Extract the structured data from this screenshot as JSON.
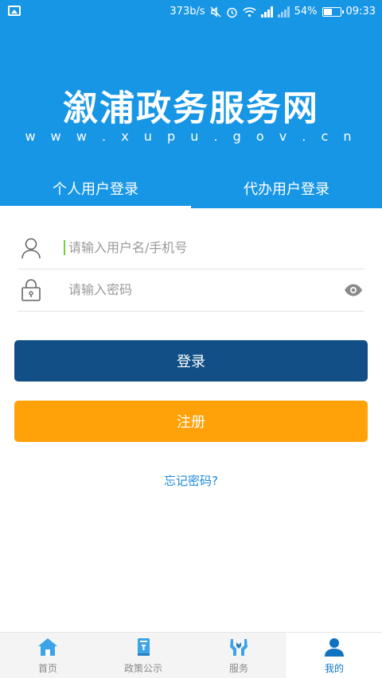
{
  "status_bar": {
    "speed": "373b/s",
    "battery_percent": "54%",
    "battery_level": 0.54,
    "time": "09:33"
  },
  "header": {
    "title": "溆浦政务服务网",
    "url": "w w w . x u p u . g o v . c n"
  },
  "login_tabs": [
    {
      "label": "个人用户登录",
      "active": true
    },
    {
      "label": "代办用户登录",
      "active": false
    }
  ],
  "form": {
    "username_placeholder": "请输入用户名/手机号",
    "password_placeholder": "请输入密码",
    "login_label": "登录",
    "register_label": "注册",
    "forgot_label": "忘记密码?"
  },
  "tabbar": [
    {
      "label": "首页",
      "icon": "home-icon"
    },
    {
      "label": "政策公示",
      "icon": "book-icon"
    },
    {
      "label": "服务",
      "icon": "handshake-icon"
    },
    {
      "label": "我的",
      "icon": "user-icon"
    }
  ],
  "colors": {
    "header_blue": "#1896e6",
    "login_button": "#114f86",
    "register_button": "#ffa109",
    "link_blue": "#1a8ad6",
    "tab_icon": "#3ba3e8"
  }
}
